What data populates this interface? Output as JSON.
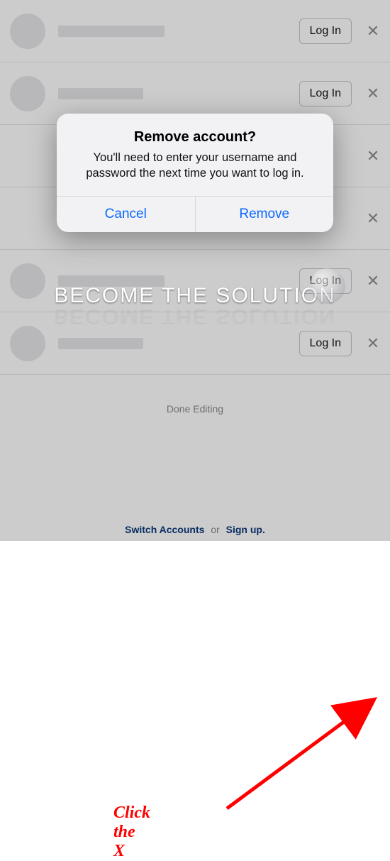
{
  "accounts": [
    {
      "login_label": "Log In"
    },
    {
      "login_label": "Log In"
    },
    {
      "login_label": ""
    },
    {
      "login_label": ""
    },
    {
      "login_label": "Log In"
    },
    {
      "login_label": "Log In"
    }
  ],
  "done_editing": "Done Editing",
  "footer": {
    "switch": "Switch Accounts",
    "or": "or",
    "signup": "Sign up."
  },
  "modal": {
    "title": "Remove account?",
    "body": "You'll need to enter your username and password the next time you want to log in.",
    "cancel": "Cancel",
    "remove": "Remove"
  },
  "watermark": "BECOME THE SOLUTION",
  "annotation_text": "Click the X"
}
